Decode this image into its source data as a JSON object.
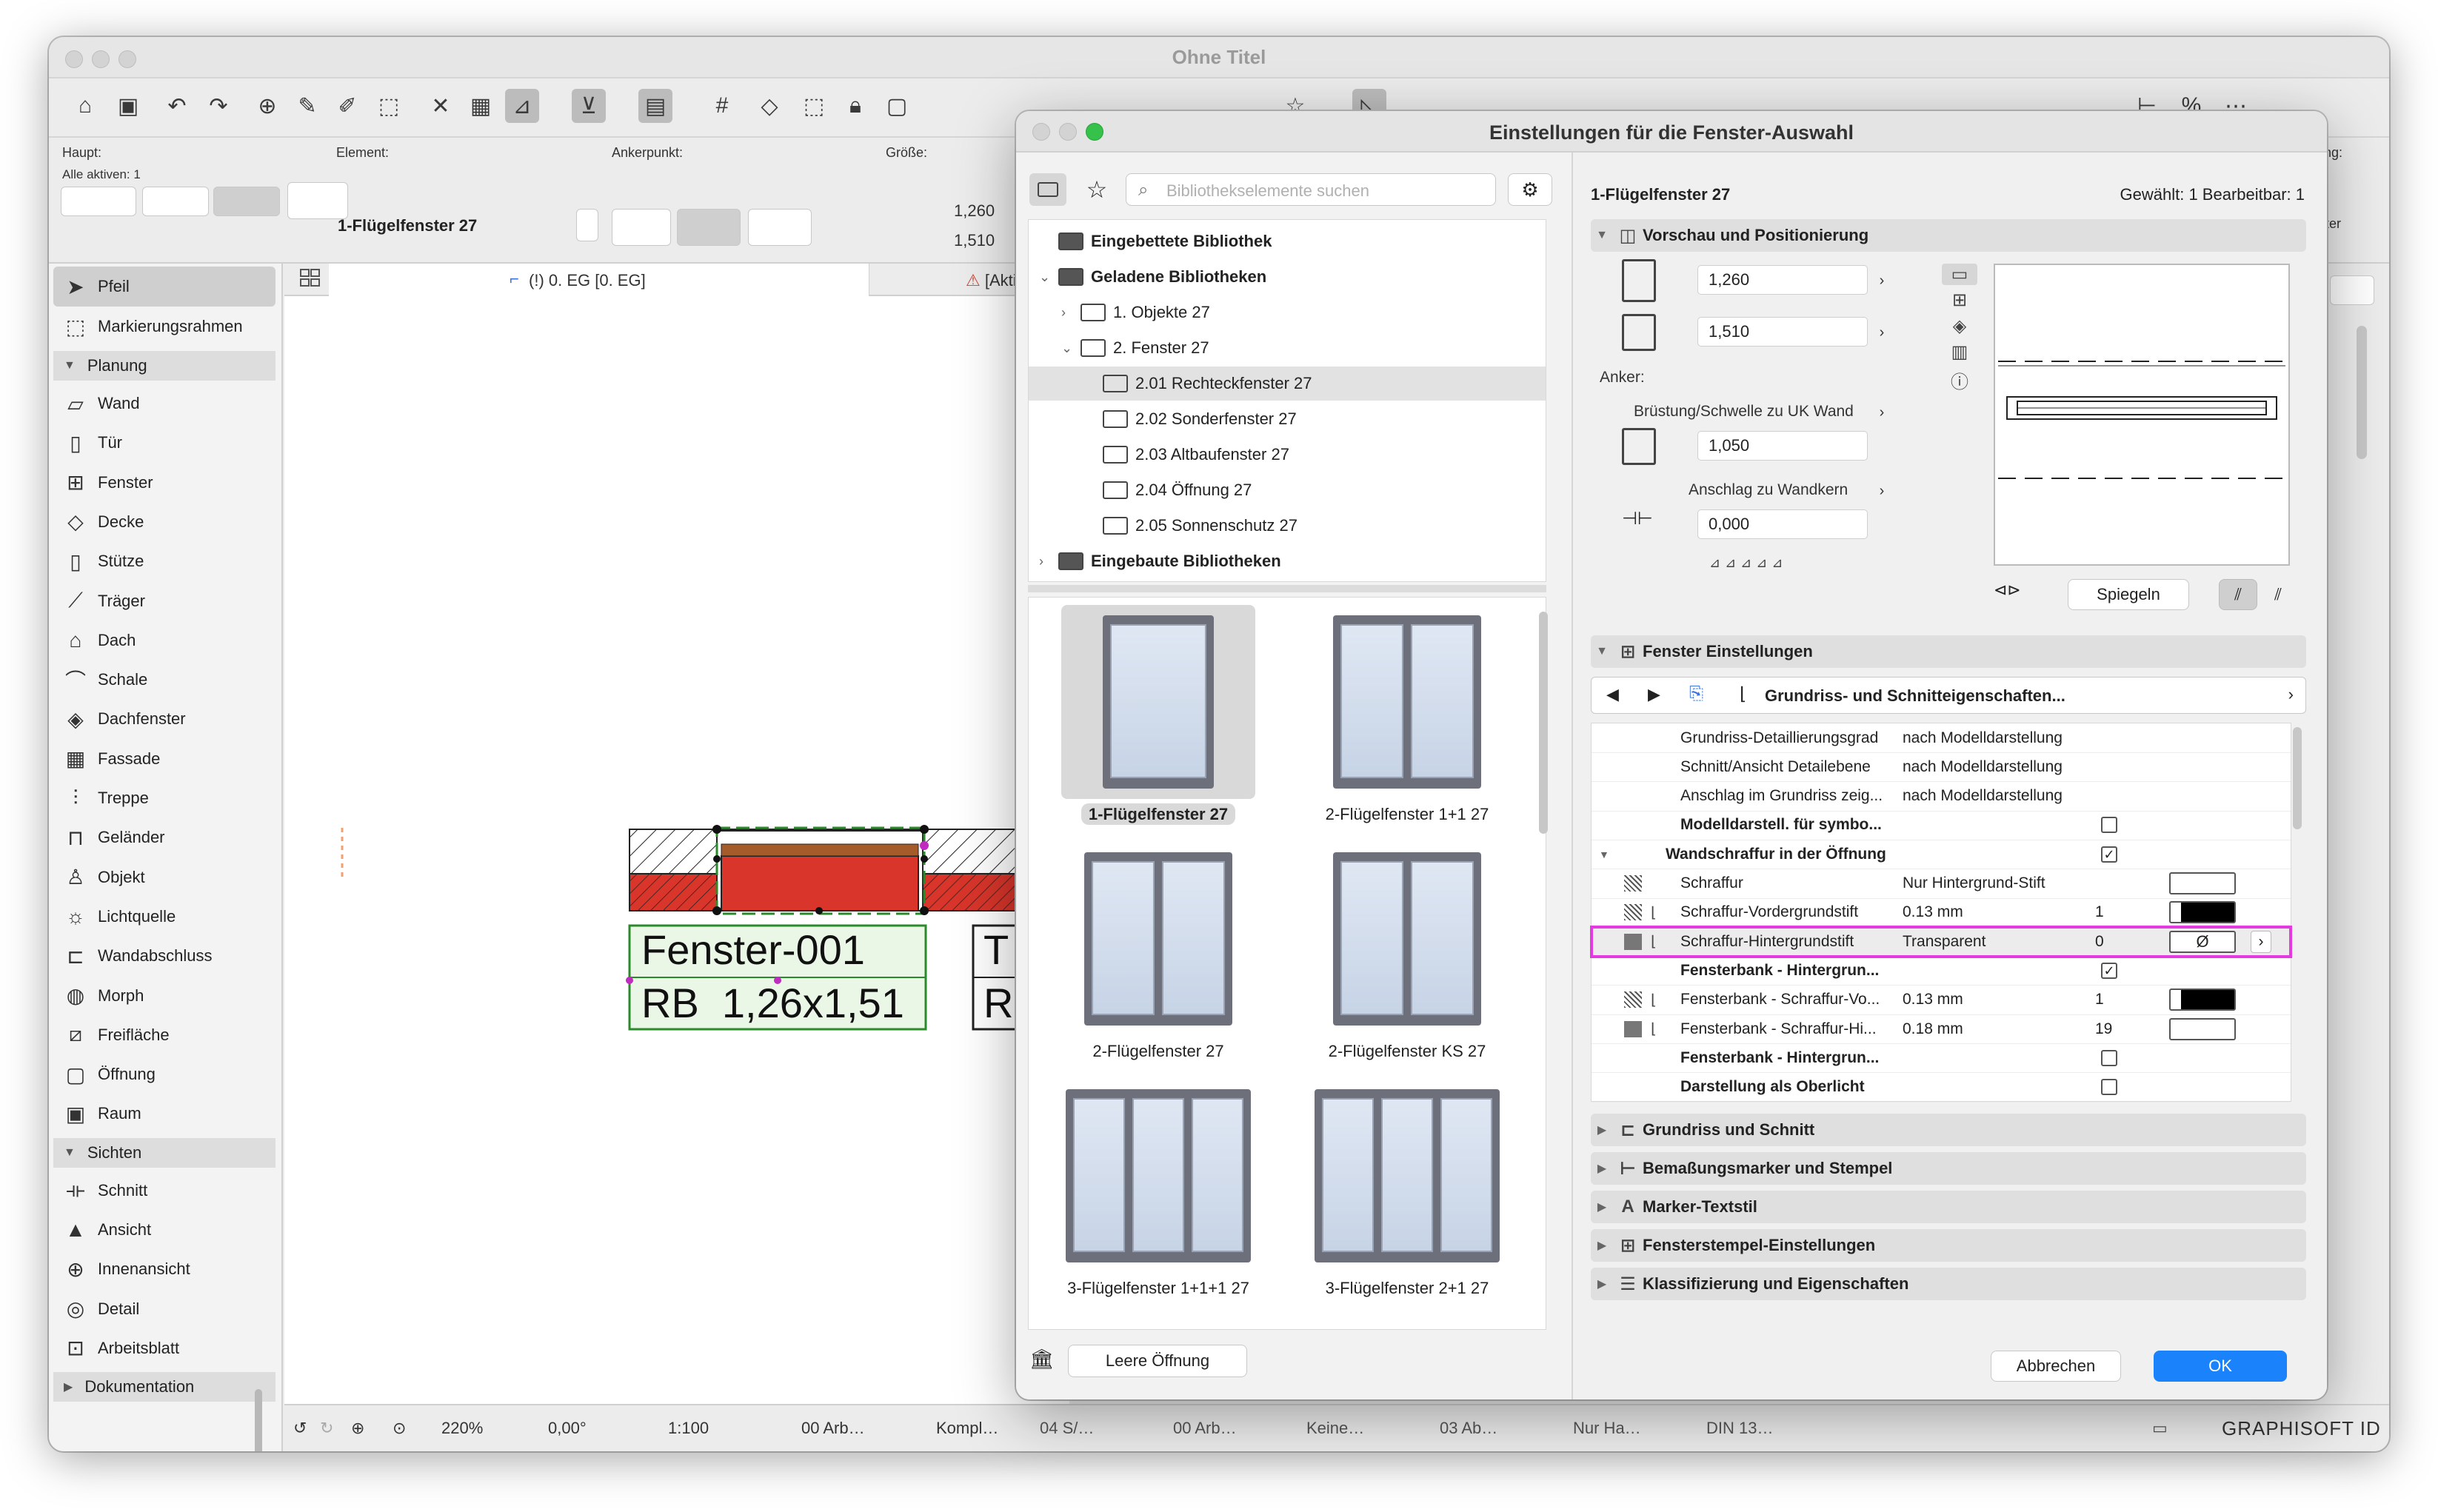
{
  "app": {
    "window_title": "Ohne Titel",
    "brand": "GRAPHISOFT ID"
  },
  "infobox": {
    "haupt_label": "Haupt:",
    "alle_aktiven": "Alle aktiven: 1",
    "element_label": "Element:",
    "element_value": "1-Flügelfenster 27",
    "anker_label": "Ankerpunkt:",
    "groesse_label": "Größe:",
    "width": "1,260",
    "height": "1,510",
    "right_partial_1": "ung:",
    "right_partial_2": "ter"
  },
  "toolbox": {
    "top_items": [
      {
        "label": "Pfeil",
        "icon": "arrow-pointer-icon",
        "selected": true
      },
      {
        "label": "Markierungsrahmen",
        "icon": "marquee-icon",
        "selected": false
      }
    ],
    "sections": [
      {
        "label": "Planung",
        "items": [
          {
            "label": "Wand",
            "icon": "wall-icon"
          },
          {
            "label": "Tür",
            "icon": "door-icon"
          },
          {
            "label": "Fenster",
            "icon": "window-icon"
          },
          {
            "label": "Decke",
            "icon": "slab-icon"
          },
          {
            "label": "Stütze",
            "icon": "column-icon"
          },
          {
            "label": "Träger",
            "icon": "beam-icon"
          },
          {
            "label": "Dach",
            "icon": "roof-icon"
          },
          {
            "label": "Schale",
            "icon": "shell-icon"
          },
          {
            "label": "Dachfenster",
            "icon": "skylight-icon"
          },
          {
            "label": "Fassade",
            "icon": "curtain-wall-icon"
          },
          {
            "label": "Treppe",
            "icon": "stair-icon"
          },
          {
            "label": "Geländer",
            "icon": "railing-icon"
          },
          {
            "label": "Objekt",
            "icon": "object-icon"
          },
          {
            "label": "Lichtquelle",
            "icon": "lamp-icon"
          },
          {
            "label": "Wandabschluss",
            "icon": "wall-end-icon"
          },
          {
            "label": "Morph",
            "icon": "morph-icon"
          },
          {
            "label": "Freifläche",
            "icon": "mesh-icon"
          },
          {
            "label": "Öffnung",
            "icon": "opening-icon"
          },
          {
            "label": "Raum",
            "icon": "zone-icon"
          }
        ]
      },
      {
        "label": "Sichten",
        "items": [
          {
            "label": "Schnitt",
            "icon": "section-icon"
          },
          {
            "label": "Ansicht",
            "icon": "elevation-icon"
          },
          {
            "label": "Innenansicht",
            "icon": "interior-elevation-icon"
          },
          {
            "label": "Detail",
            "icon": "detail-icon"
          },
          {
            "label": "Arbeitsblatt",
            "icon": "worksheet-icon"
          }
        ]
      },
      {
        "label": "Dokumentation",
        "items": []
      }
    ]
  },
  "canvas": {
    "tab_label": "(!) 0. EG [0. EG]",
    "tab2_label": "[Aktions-",
    "label_1_line1": "Fenster-001",
    "label_1_line2": "RB  1,26x1,51",
    "label_2_line1": "T",
    "label_2_line2": "R"
  },
  "statusbar": {
    "zoom": "220%",
    "angle": "0,00°",
    "scale": "1:100",
    "layer": "00 Arb…",
    "items": [
      "Kompl…",
      "04 S/…",
      "00 Arb…",
      "Keine…",
      "03 Ab…",
      "Nur Ha…",
      "DIN 13…"
    ]
  },
  "dialog": {
    "title": "Einstellungen für die Fenster-Auswahl",
    "search_placeholder": "Bibliothekselemente suchen",
    "tree": [
      {
        "label": "Eingebettete Bibliothek",
        "bold": true,
        "level": 0
      },
      {
        "label": "Geladene Bibliotheken",
        "bold": true,
        "level": 0
      },
      {
        "label": "1. Objekte 27",
        "bold": false,
        "level": 1
      },
      {
        "label": "2. Fenster 27",
        "bold": false,
        "level": 1
      },
      {
        "label": "2.01 Rechteckfenster 27",
        "bold": false,
        "level": 2,
        "selected": true
      },
      {
        "label": "2.02 Sonderfenster 27",
        "bold": false,
        "level": 2
      },
      {
        "label": "2.03 Altbaufenster 27",
        "bold": false,
        "level": 2
      },
      {
        "label": "2.04 Öffnung 27",
        "bold": false,
        "level": 2
      },
      {
        "label": "2.05 Sonnenschutz 27",
        "bold": false,
        "level": 2
      },
      {
        "label": "Eingebaute Bibliotheken",
        "bold": true,
        "level": 0
      }
    ],
    "thumbnails": [
      {
        "label": "1-Flügelfenster 27",
        "selected": true,
        "panes": 1
      },
      {
        "label": "2-Flügelfenster 1+1 27",
        "selected": false,
        "panes": 2
      },
      {
        "label": "2-Flügelfenster 27",
        "selected": false,
        "panes": 2
      },
      {
        "label": "2-Flügelfenster KS 27",
        "selected": false,
        "panes": 2
      },
      {
        "label": "3-Flügelfenster 1+1+1 27",
        "selected": false,
        "panes": 3
      },
      {
        "label": "3-Flügelfenster 2+1 27",
        "selected": false,
        "panes": 3
      }
    ],
    "leere_oeffnung": "Leere Öffnung",
    "element_name": "1-Flügelfenster 27",
    "selection_info": "Gewählt: 1 Bearbeitbar: 1",
    "preview_section": "Vorschau und Positionierung",
    "width_value": "1,260",
    "height_value": "1,510",
    "anker_label": "Anker:",
    "bruestung_label": "Brüstung/Schwelle zu UK Wand",
    "bruestung_value": "1,050",
    "anschlag_label": "Anschlag zu Wandkern",
    "anschlag_value": "0,000",
    "spiegeln": "Spiegeln",
    "fenster_einstellungen": "Fenster Einstellungen",
    "dropdown_label": "Grundriss- und Schnitteigenschaften...",
    "props": [
      {
        "name": "Grundriss-Detaillierungsgrad",
        "value": "nach Modelldarstellung",
        "num": "",
        "type": "text"
      },
      {
        "name": "Schnitt/Ansicht Detailebene",
        "value": "nach Modelldarstellung",
        "num": "",
        "type": "text"
      },
      {
        "name": "Anschlag im Grundriss zeig...",
        "value": "nach Modelldarstellung",
        "num": "",
        "type": "text"
      },
      {
        "name": "Modelldarstell. für symbo...",
        "value": "",
        "num": "",
        "type": "check",
        "checked": false,
        "bold": true
      },
      {
        "name": "Wandschraffur in der Öffnung",
        "value": "",
        "num": "",
        "type": "check",
        "checked": true,
        "bold": true,
        "group": true
      },
      {
        "name": "Schraffur",
        "value": "Nur Hintergrund-Stift",
        "num": "",
        "type": "swatch-empty"
      },
      {
        "name": "Schraffur-Vordergrundstift",
        "value": "0.13 mm",
        "num": "1",
        "type": "swatch-black"
      },
      {
        "name": "Schraffur-Hintergrundstift",
        "value": "Transparent",
        "num": "0",
        "type": "swatch-none",
        "highlight": true
      },
      {
        "name": "Fensterbank - Hintergrun...",
        "value": "",
        "num": "",
        "type": "check",
        "checked": true,
        "bold": true
      },
      {
        "name": "Fensterbank - Schraffur-Vo...",
        "value": "0.13 mm",
        "num": "1",
        "type": "swatch-black"
      },
      {
        "name": "Fensterbank - Schraffur-Hi...",
        "value": "0.18 mm",
        "num": "19",
        "type": "swatch-empty"
      },
      {
        "name": "Fensterbank - Hintergrun...",
        "value": "",
        "num": "",
        "type": "check",
        "checked": false,
        "bold": true
      },
      {
        "name": "Darstellung als Oberlicht",
        "value": "",
        "num": "",
        "type": "check",
        "checked": false,
        "bold": true
      }
    ],
    "none_symbol": "Ø",
    "check_symbol": "✓",
    "collapsed_sections": [
      {
        "label": "Grundriss und Schnitt",
        "icon": "floorplan-icon"
      },
      {
        "label": "Bemaßungsmarker und Stempel",
        "icon": "dimension-icon"
      },
      {
        "label": "Marker-Textstil",
        "icon": "text-style-icon"
      },
      {
        "label": "Fensterstempel-Einstellungen",
        "icon": "stamp-icon"
      },
      {
        "label": "Klassifizierung und Eigenschaften",
        "icon": "classification-icon"
      }
    ],
    "cancel": "Abbrechen",
    "ok": "OK",
    "accent": "#1a82fb",
    "highlight_color": "#e43be0"
  }
}
